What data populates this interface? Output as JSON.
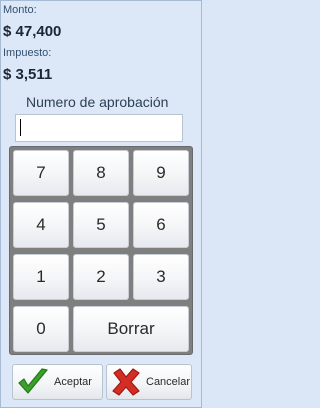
{
  "amount": {
    "label": "Monto:",
    "value": "$ 47,400"
  },
  "tax": {
    "label": "Impuesto:",
    "value": "$ 3,511"
  },
  "approval": {
    "label": "Numero de aprobación",
    "value": ""
  },
  "keypad": {
    "keys": [
      "7",
      "8",
      "9",
      "4",
      "5",
      "6",
      "1",
      "2",
      "3",
      "0"
    ],
    "clear_label": "Borrar"
  },
  "footer": {
    "accept_label": "Aceptar",
    "cancel_label": "Cancelar",
    "accept_icon": "check-icon",
    "cancel_icon": "x-icon",
    "accept_color": "#3aa02a",
    "cancel_color": "#d42d24"
  }
}
